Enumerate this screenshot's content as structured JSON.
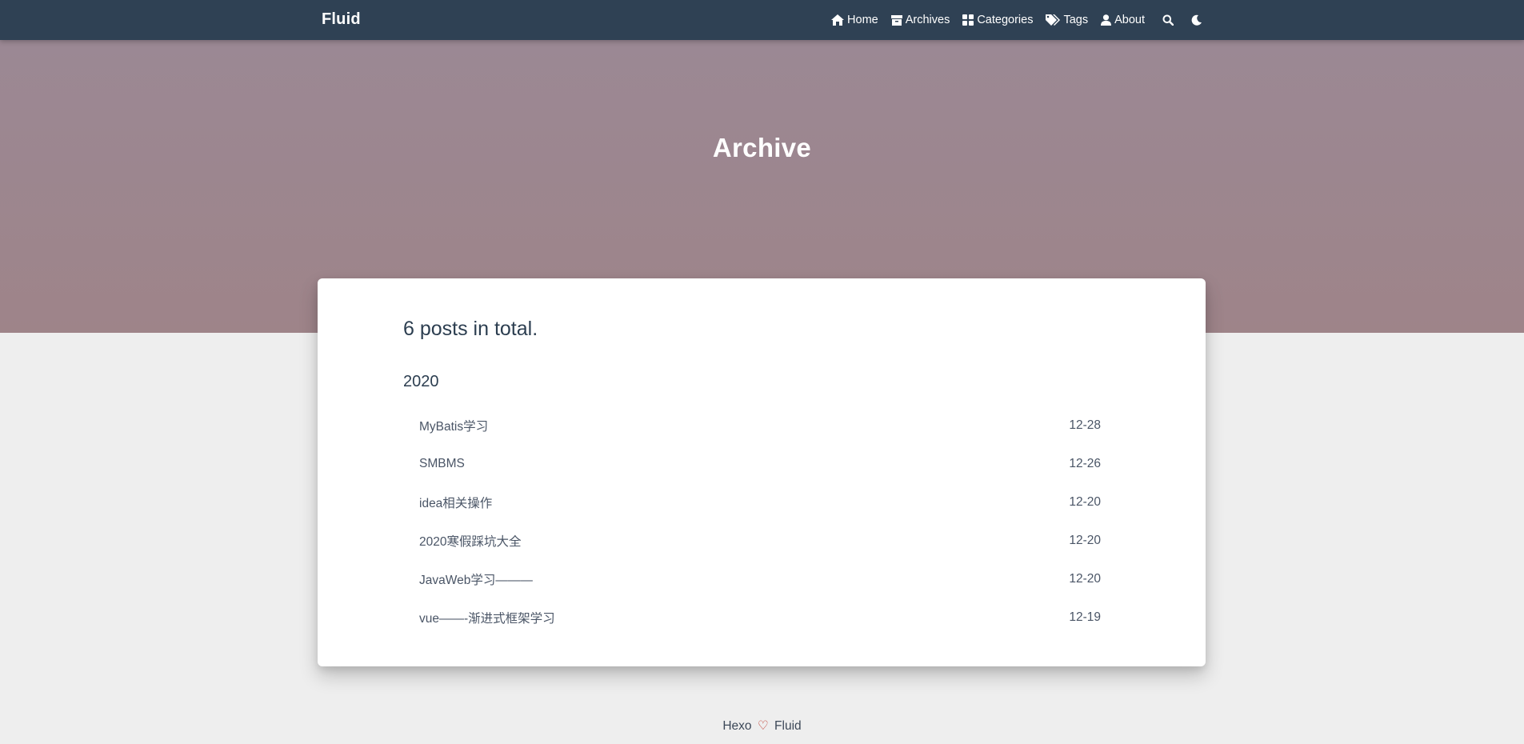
{
  "navbar": {
    "brand": "Fluid",
    "links": [
      {
        "label": "Home",
        "icon": "home-icon"
      },
      {
        "label": "Archives",
        "icon": "archive-icon"
      },
      {
        "label": "Categories",
        "icon": "grid-icon"
      },
      {
        "label": "Tags",
        "icon": "tags-icon"
      },
      {
        "label": "About",
        "icon": "user-icon"
      }
    ],
    "icons": [
      "search-icon",
      "moon-icon"
    ]
  },
  "banner": {
    "title": "Archive"
  },
  "archive": {
    "total_text": "6 posts in total.",
    "year": "2020",
    "posts": [
      {
        "title": "MyBatis学习",
        "date": "12-28"
      },
      {
        "title": "SMBMS",
        "date": "12-26"
      },
      {
        "title": "idea相关操作",
        "date": "12-20"
      },
      {
        "title": "2020寒假踩坑大全",
        "date": "12-20"
      },
      {
        "title": "JavaWeb学习———",
        "date": "12-20"
      },
      {
        "title": "vue——-渐进式框架学习",
        "date": "12-19"
      }
    ]
  },
  "footer": {
    "left": "Hexo",
    "heart": "♡",
    "right": "Fluid"
  },
  "colors": {
    "navbar": "#2f4154",
    "banner": "#9b8894",
    "page_bg": "#eeeeee",
    "card_bg": "#ffffff",
    "text": "#3c4858"
  }
}
